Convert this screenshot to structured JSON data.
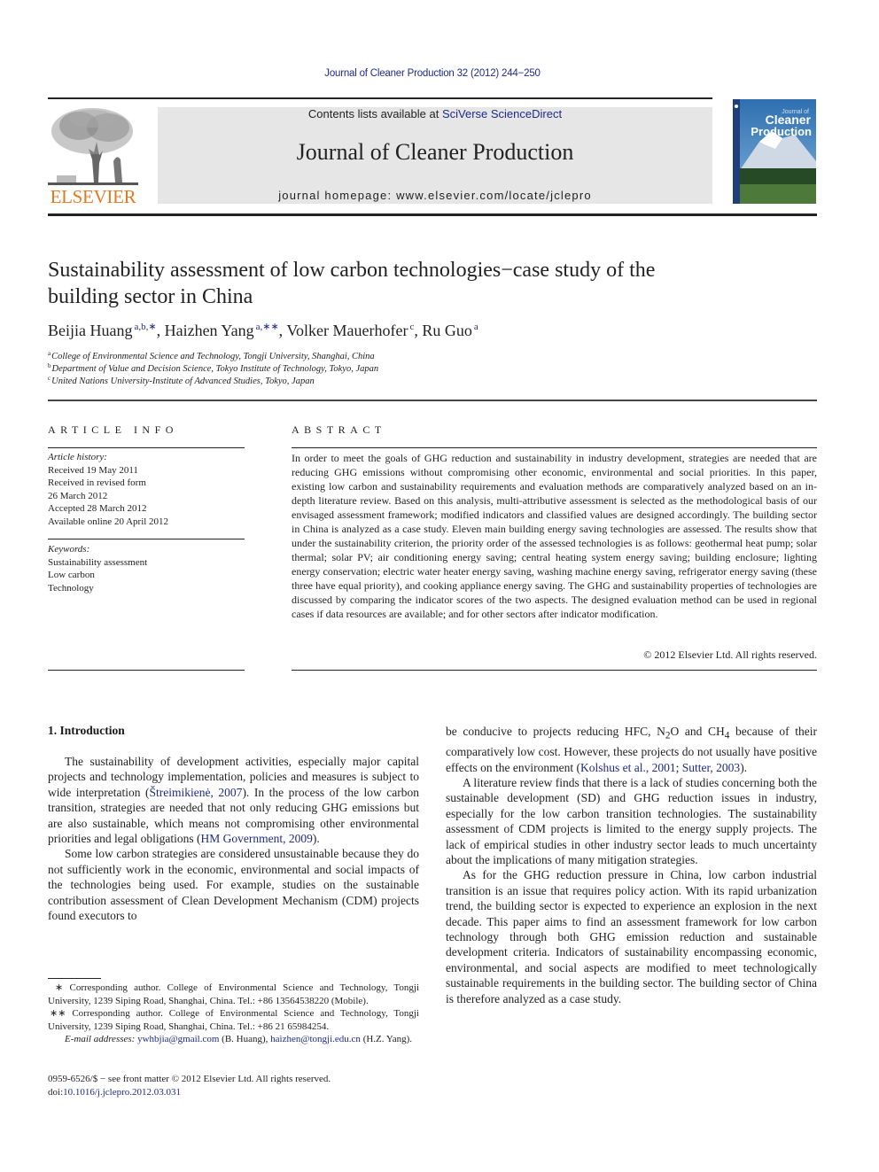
{
  "header": {
    "citation": "Journal of Cleaner Production 32 (2012) 244−250",
    "contents_prefix": "Contents lists available at ",
    "contents_link": "SciVerse ScienceDirect",
    "journal_title": "Journal of Cleaner Production",
    "homepage": "journal homepage: www.elsevier.com/locate/jclepro",
    "publisher_logo_text": "ELSEVIER",
    "cover": {
      "title_small": "Journal of",
      "title_line1": "Cleaner",
      "title_line2": "Production"
    },
    "colors": {
      "link": "#1f2a8a",
      "elsevier_orange": "#e8771e",
      "banner_bg": "#e6e6e6"
    }
  },
  "article": {
    "title_line1": "Sustainability assessment of low carbon technologies−case study of the",
    "title_line2": "building sector in China",
    "authors": [
      {
        "name": "Beijia Huang",
        "sup": "a,b,∗",
        "sep": ", "
      },
      {
        "name": "Haizhen Yang",
        "sup": "a,∗∗",
        "sep": ", "
      },
      {
        "name": "Volker Mauerhofer",
        "sup": "c",
        "sep": ", "
      },
      {
        "name": "Ru Guo",
        "sup": "a",
        "sep": ""
      }
    ],
    "affiliations": [
      {
        "key": "a",
        "text": "College of Environmental Science and Technology, Tongji University, Shanghai, China"
      },
      {
        "key": "b",
        "text": "Department of Value and Decision Science, Tokyo Institute of Technology, Tokyo, Japan"
      },
      {
        "key": "c",
        "text": "United Nations University-Institute of Advanced Studies, Tokyo, Japan"
      }
    ]
  },
  "article_info": {
    "heading": "ARTICLE INFO",
    "history_label": "Article history:",
    "history": [
      "Received 19 May 2011",
      "Received in revised form",
      "26 March 2012",
      "Accepted 28 March 2012",
      "Available online 20 April 2012"
    ],
    "keywords_label": "Keywords:",
    "keywords": [
      "Sustainability assessment",
      "Low carbon",
      "Technology"
    ]
  },
  "abstract": {
    "heading": "ABSTRACT",
    "text": "In order to meet the goals of GHG reduction and sustainability in industry development, strategies are needed that are reducing GHG emissions without compromising other economic, environmental and social priorities. In this paper, existing low carbon and sustainability requirements and evaluation methods are comparatively analyzed based on an in-depth literature review. Based on this analysis, multi-attributive assessment is selected as the methodological basis of our envisaged assessment framework; modified indicators and classified values are designed accordingly. The building sector in China is analyzed as a case study. Eleven main building energy saving technologies are assessed. The results show that under the sustainability criterion, the priority order of the assessed technologies is as follows: geothermal heat pump; solar thermal; solar PV; air conditioning energy saving; central heating system energy saving; building enclosure; lighting energy conservation; electric water heater energy saving, washing machine energy saving, refrigerator energy saving (these three have equal priority), and cooking appliance energy saving. The GHG and sustainability properties of technologies are discussed by comparing the indicator scores of the two aspects. The designed evaluation method can be used in regional cases if data resources are available; and for other sectors after indicator modification.",
    "copyright": "© 2012 Elsevier Ltd. All rights reserved."
  },
  "body": {
    "section_heading": "1.  Introduction",
    "left": {
      "p1_a": "The sustainability of development activities, especially major capital projects and technology implementation, policies and measures is subject to wide interpretation (",
      "p1_ref1": "Štreimikienė, 2007",
      "p1_b": "). In the process of the low carbon transition, strategies are needed that not only reducing GHG emissions but are also sustainable, which means not compromising other environmental priorities and legal obligations (",
      "p1_ref2": "HM Government, 2009",
      "p1_c": ").",
      "p2": "Some low carbon strategies are considered unsustainable because they do not sufficiently work in the economic, environmental and social impacts of the technologies being used. For example, studies on the sustainable contribution assessment of Clean Development Mechanism (CDM) projects found executors to"
    },
    "right": {
      "p1_a": "be conducive to projects reducing HFC, N",
      "p1_sub1": "2",
      "p1_b": "O and CH",
      "p1_sub2": "4",
      "p1_c": " because of their comparatively low cost. However, these projects do not usually have positive effects on the environment (",
      "p1_ref1": "Kolshus et al., 2001",
      "p1_d": "; ",
      "p1_ref2": "Sutter, 2003",
      "p1_e": ").",
      "p2": "A literature review finds that there is a lack of studies concerning both the sustainable development (SD) and GHG reduction issues in industry, especially for the low carbon transition technologies. The sustainability assessment of CDM projects is limited to the energy supply projects. The lack of empirical studies in other industry sector leads to much uncertainty about the implications of many mitigation strategies.",
      "p3": "As for the GHG reduction pressure in China, low carbon industrial transition is an issue that requires policy action. With its rapid urbanization trend, the building sector is expected to experience an explosion in the next decade. This paper aims to find an assessment framework for low carbon technology through both GHG emission reduction and sustainable development criteria. Indicators of sustainability encompassing economic, environmental, and social aspects are modified to meet technologically sustainable requirements in the building sector. The building sector of China is therefore analyzed as a case study."
    }
  },
  "footnotes": {
    "fn1": "∗  Corresponding author. College of Environmental Science and Technology, Tongji University, 1239 Siping Road, Shanghai, China. Tel.: +86 13564538220 (Mobile).",
    "fn2": "∗∗  Corresponding author. College of Environmental Science and Technology, Tongji University, 1239 Siping Road, Shanghai, China. Tel.: +86 21 65984254.",
    "email_label": "E-mail addresses:",
    "email1": "ywhbjia@gmail.com",
    "email1_name": " (B. Huang), ",
    "email2": "haizhen@tongji.edu.cn",
    "email2_name": " (H.Z. Yang).",
    "front_matter": "0959-6526/$ − see front matter © 2012 Elsevier Ltd. All rights reserved.",
    "doi_prefix": "doi:",
    "doi": "10.1016/j.jclepro.2012.03.031"
  }
}
